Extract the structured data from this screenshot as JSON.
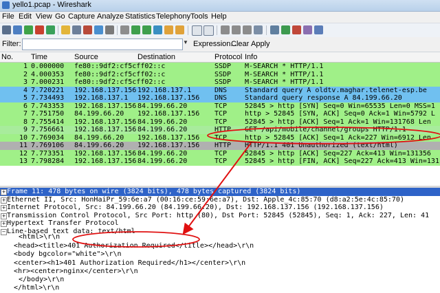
{
  "window": {
    "title": "yello1.pcap - Wireshark"
  },
  "menu": [
    "File",
    "Edit",
    "View",
    "Go",
    "Capture",
    "Analyze",
    "Statistics",
    "Telephony",
    "Tools",
    "Help"
  ],
  "filter": {
    "label": "Filter:",
    "value": "",
    "expression": "Expression...",
    "clear": "Clear",
    "apply": "Apply"
  },
  "columns": [
    "No.",
    "Time",
    "Source",
    "Destination",
    "Protocol",
    "Info"
  ],
  "colors": {
    "green": "#a0f088",
    "blue": "#70c0f0",
    "lightgreen": "#a8ec9c",
    "gray": "#b0b0b0",
    "selected": "#2e63c8"
  },
  "packets": [
    {
      "no": "1",
      "time": "0.000000",
      "src": "fe80::9df2:cf5cff02::c",
      "dst": "",
      "proto": "SSDP",
      "info": "M-SEARCH * HTTP/1.1",
      "color": "#a0f088"
    },
    {
      "no": "2",
      "time": "4.000353",
      "src": "fe80::9df2:cf5cff02::c",
      "dst": "",
      "proto": "SSDP",
      "info": "M-SEARCH * HTTP/1.1",
      "color": "#a0f088"
    },
    {
      "no": "3",
      "time": "7.000231",
      "src": "fe80::9df2:cf5cff02::c",
      "dst": "",
      "proto": "SSDP",
      "info": "M-SEARCH * HTTP/1.1",
      "color": "#a0f088"
    },
    {
      "no": "4",
      "time": "7.720221",
      "src": "192.168.137.156",
      "dst": "192.168.137.1",
      "proto": "DNS",
      "info": "Standard query A oldtv.maghar.telenet-esp.be",
      "color": "#70c0f0"
    },
    {
      "no": "5",
      "time": "7.734493",
      "src": "192.168.137.1",
      "dst": "192.168.137.156",
      "proto": "DNS",
      "info": "Standard query response A 84.199.66.20",
      "color": "#70c0f0"
    },
    {
      "no": "6",
      "time": "7.743353",
      "src": "192.168.137.156",
      "dst": "84.199.66.20",
      "proto": "TCP",
      "info": "52845 > http [SYN] Seq=0 Win=65535 Len=0 MSS=1",
      "color": "#a0f088"
    },
    {
      "no": "7",
      "time": "7.751750",
      "src": "84.199.66.20",
      "dst": "192.168.137.156",
      "proto": "TCP",
      "info": "http > 52845 [SYN, ACK] Seq=0 Ack=1 Win=5792 L",
      "color": "#a0f088"
    },
    {
      "no": "8",
      "time": "7.755414",
      "src": "192.168.137.156",
      "dst": "84.199.66.20",
      "proto": "TCP",
      "info": "52845 > http [ACK] Seq=1 Ack=1 Win=131768 Len",
      "color": "#a0f088"
    },
    {
      "no": "9",
      "time": "7.756661",
      "src": "192.168.137.156",
      "dst": "84.199.66.20",
      "proto": "HTTP",
      "info": "GET /api/mobile/channel/groups HTTP/1.1",
      "color": "#a8ec9c"
    },
    {
      "no": "10",
      "time": "7.769034",
      "src": "84.199.66.20",
      "dst": "192.168.137.156",
      "proto": "TCP",
      "info": "http > 52845 [ACK] Seq=1 Ack=227 Win=6912 Len",
      "color": "#a0f088"
    },
    {
      "no": "11",
      "time": "7.769106",
      "src": "84.199.66.20",
      "dst": "192.168.137.156",
      "proto": "HTTP",
      "info": "HTTP/1.1 401 Unauthorized  (text/html)",
      "color": "#b0b0b0"
    },
    {
      "no": "12",
      "time": "7.773351",
      "src": "192.168.137.156",
      "dst": "84.199.66.20",
      "proto": "TCP",
      "info": "52845 > http [ACK] Seq=227 Ack=413 Win=131356",
      "color": "#a0f088"
    },
    {
      "no": "13",
      "time": "7.798284",
      "src": "192.168.137.156",
      "dst": "84.199.66.20",
      "proto": "TCP",
      "info": "52845 > http [FIN, ACK] Seq=227 Ack=413 Win=131",
      "color": "#a0f088"
    }
  ],
  "details": [
    {
      "text": "Frame 11: 478 bytes on wire (3824 bits), 478 bytes captured (3824 bits)",
      "toggle": "+",
      "selected": true
    },
    {
      "text": "Ethernet II, Src: HonHaiPr_59:6e:a7 (00:16:ce:59:6e:a7), Dst: Apple_4c:85:70 (d8:a2:5e:4c:85:70)",
      "toggle": "+",
      "selected": false
    },
    {
      "text": "Internet Protocol, Src: 84.199.66.20 (84.199.66.20), Dst: 192.168.137.156 (192.168.137.156)",
      "toggle": "+",
      "selected": false
    },
    {
      "text": "Transmission Control Protocol, Src Port: http (80), Dst Port: 52845 (52845), Seq: 1, Ack: 227, Len: 41",
      "toggle": "+",
      "selected": false
    },
    {
      "text": "Hypertext Transfer Protocol",
      "toggle": "+",
      "selected": false
    },
    {
      "text": "Line-based text data: text/html",
      "toggle": "−",
      "selected": false
    }
  ],
  "body_lines": [
    "<html>\\r\\n",
    "<head><title>401 Authorization Required</title></head>\\r\\n",
    "<body bgcolor=\"white\">\\r\\n",
    "<center><h1>401 Authorization Required</h1></center>\\r\\n",
    "<hr><center>nginx</center>\\r\\n",
    "</body>\\r\\n",
    "</html>\\r\\n"
  ]
}
